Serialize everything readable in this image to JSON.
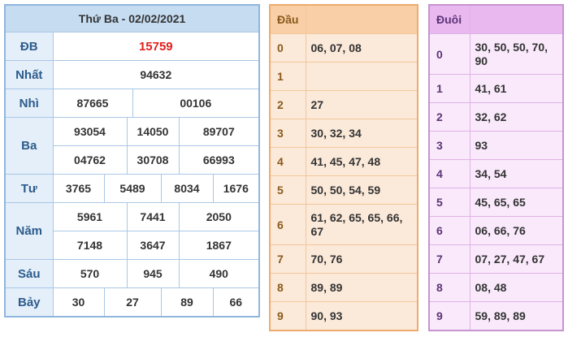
{
  "results": {
    "title": "Thứ Ba - 02/02/2021",
    "rows": {
      "db": {
        "label": "ĐB",
        "values": [
          "15759"
        ]
      },
      "nhat": {
        "label": "Nhất",
        "values": [
          "94632"
        ]
      },
      "nhi": {
        "label": "Nhì",
        "values": [
          "87665",
          "00106"
        ]
      },
      "ba": {
        "label": "Ba",
        "values": [
          "93054",
          "14050",
          "89707",
          "04762",
          "30708",
          "66993"
        ]
      },
      "tu": {
        "label": "Tư",
        "values": [
          "3765",
          "5489",
          "8034",
          "1676"
        ]
      },
      "nam": {
        "label": "Năm",
        "values": [
          "5961",
          "7441",
          "2050",
          "7148",
          "3647",
          "1867"
        ]
      },
      "sau": {
        "label": "Sáu",
        "values": [
          "570",
          "945",
          "490"
        ]
      },
      "bay": {
        "label": "Bảy",
        "values": [
          "30",
          "27",
          "89",
          "66"
        ]
      }
    },
    "colors": {
      "special": "#e0201d",
      "header": "#c5dcf1",
      "label_bg": "#e4eff9"
    }
  },
  "dau": {
    "header": "Đầu",
    "rows": [
      {
        "key": "0",
        "value": "06, 07, 08"
      },
      {
        "key": "1",
        "value": ""
      },
      {
        "key": "2",
        "value": "27"
      },
      {
        "key": "3",
        "value": "30, 32, 34"
      },
      {
        "key": "4",
        "value": "41, 45, 47, 48"
      },
      {
        "key": "5",
        "value": "50, 50, 54, 59"
      },
      {
        "key": "6",
        "value": "61, 62, 65, 65, 66, 67"
      },
      {
        "key": "7",
        "value": "70, 76"
      },
      {
        "key": "8",
        "value": "89, 89"
      },
      {
        "key": "9",
        "value": "90, 93"
      }
    ]
  },
  "duoi": {
    "header": "Đuôi",
    "rows": [
      {
        "key": "0",
        "value": "30, 50, 50, 70, 90"
      },
      {
        "key": "1",
        "value": "41, 61"
      },
      {
        "key": "2",
        "value": "32, 62"
      },
      {
        "key": "3",
        "value": "93"
      },
      {
        "key": "4",
        "value": "34, 54"
      },
      {
        "key": "5",
        "value": "45, 65, 65"
      },
      {
        "key": "6",
        "value": "06, 66, 76"
      },
      {
        "key": "7",
        "value": "07, 27, 47, 67"
      },
      {
        "key": "8",
        "value": "08, 48"
      },
      {
        "key": "9",
        "value": "59, 89, 89"
      }
    ]
  }
}
